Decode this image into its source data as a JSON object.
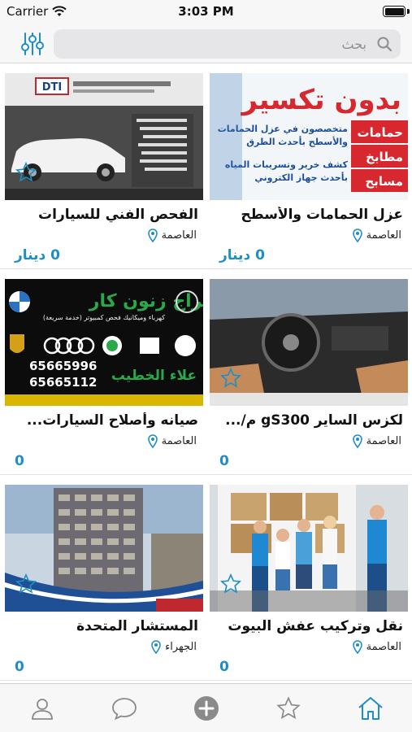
{
  "status_bar": {
    "carrier": "Carrier",
    "time": "3:03 PM"
  },
  "search": {
    "placeholder": "بحث"
  },
  "colors": {
    "accent": "#1e8ec5",
    "icon_gray": "#8a8a8a"
  },
  "listings": [
    {
      "title": "عزل الحمامات والأسطح",
      "location": "العاصمة",
      "price": "0 دينار",
      "ad_lines": [
        "بدون تكسير",
        "متخصصون في عزل الحمامات",
        "والأسطح بأحدث الطرق",
        "كشف خرير وتسريبات المياه",
        "بأحدث جهاز الكتروني",
        "حمامات",
        "مطابخ",
        "مسابح"
      ]
    },
    {
      "title": "الفحص الفني للسيارات",
      "location": "العاصمة",
      "price": "0 دينار",
      "ad_lines": [
        "DTI"
      ]
    },
    {
      "title": "لكزس الساير gS300 م/...",
      "location": "العاصمة",
      "price": "0",
      "ad_lines": []
    },
    {
      "title": "صيانه وأصلاح السيارات...",
      "location": "العاصمة",
      "price": "0",
      "ad_lines": [
        "كراج زنون كار",
        "كهرباء وميكانيك فحص كمبيوتر (خدمة سريعة)",
        "65665996",
        "65665112",
        "علاء الخطيب"
      ]
    },
    {
      "title": "نقل وتركيب عفش البيوت",
      "location": "العاصمة",
      "price": "0",
      "ad_lines": []
    },
    {
      "title": "المستشار المتحدة",
      "location": "الجهراء",
      "price": "0",
      "ad_lines": []
    }
  ],
  "tabs": [
    {
      "name": "home"
    },
    {
      "name": "favorites"
    },
    {
      "name": "add"
    },
    {
      "name": "messages"
    },
    {
      "name": "profile"
    }
  ]
}
